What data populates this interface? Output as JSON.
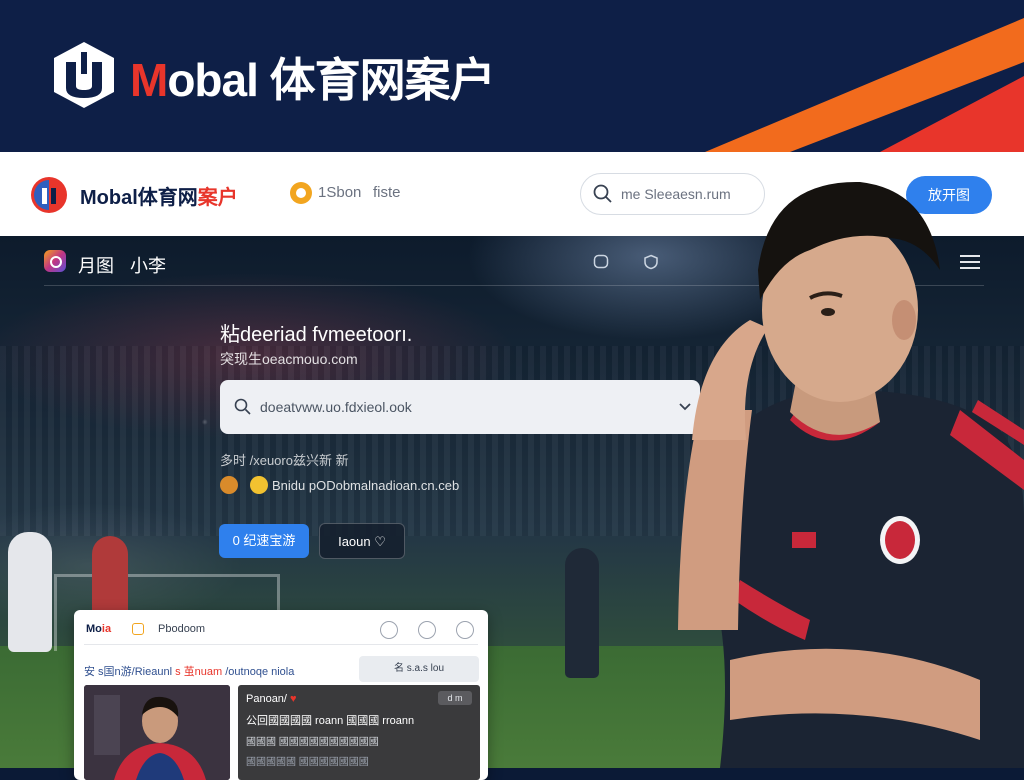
{
  "banner": {
    "brand_m": "M",
    "brand_rest": "obal 体育网案户",
    "logo_icon": "shield-u-logo-icon",
    "colors": {
      "navy": "#0e1f47",
      "orange": "#f26b1d",
      "red": "#e8352b"
    }
  },
  "header": {
    "brand_main": "Mobal体育网",
    "brand_accent": "案户",
    "link_1": "1Sbon",
    "link_2": "fiste",
    "search_placeholder": "me Sleeaesn.rum",
    "action_button": "放开图",
    "accent": "#2f80ed"
  },
  "hero": {
    "nav_1": "月图",
    "nav_2": "小李",
    "title": "粘deeriad fvmeetoorı.",
    "subtitle": "突现生oeacmouo.com",
    "search_placeholder": "doeatvww.uo.fdxieol.ook",
    "note": "多时 /xeuoro兹兴新 新",
    "row_text": "Bnidu pODobmalnadioan.cn.ceb",
    "button_primary": "0 纪速宝游",
    "button_secondary": "Iaoun ♡"
  },
  "card": {
    "brand_main": "Mo",
    "brand_accent": "ia",
    "link": "Pbodoom",
    "tag_blue": "安 s国n游/Rieaunl",
    "tag_red": "s 茧nuam",
    "tag_rest": " /outnoqe niola",
    "pill": "名 s.a.s lou",
    "dark_title": "Panoan/",
    "dark_heart": "♥",
    "dark_badge": "d m",
    "dark_line2": "公回國國國國 roann 國國國 rroann",
    "dark_line3": "國國國 國國國國國國國國國國",
    "dark_line4": "國國國國國 國國國國國國國"
  }
}
